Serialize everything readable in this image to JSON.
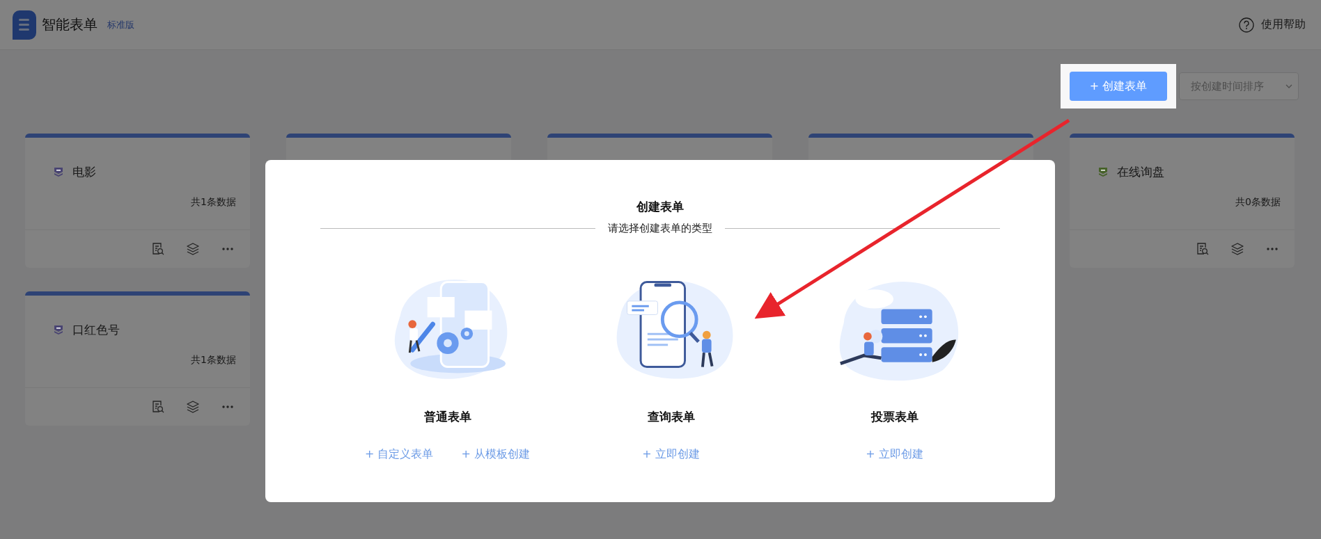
{
  "header": {
    "title": "智能表单",
    "edition": "标准版",
    "help": "使用帮助"
  },
  "toolbar": {
    "create_button": "+ 创建表单",
    "sort_select": {
      "value": "按创建时间排序"
    }
  },
  "cards": [
    {
      "kind": "form",
      "title": "电影",
      "count": "共1条数据",
      "color": "#494472"
    },
    {
      "kind": "covered"
    },
    {
      "kind": "covered"
    },
    {
      "kind": "covered"
    },
    {
      "kind": "form",
      "title": "在线询盘",
      "count": "共0条数据",
      "color": "#47622a"
    },
    {
      "kind": "form",
      "title": "口红色号",
      "count": "共1条数据",
      "color": "#494472"
    }
  ],
  "dialog": {
    "title": "创建表单",
    "subtitle": "请选择创建表单的类型",
    "types": [
      {
        "kind": "tools",
        "name": "普通表单",
        "links": [
          "+ 自定义表单",
          "+ 从模板创建"
        ]
      },
      {
        "kind": "search",
        "name": "查询表单",
        "links": [
          "+ 立即创建"
        ]
      },
      {
        "kind": "server",
        "name": "投票表单",
        "links": [
          "+ 立即创建"
        ]
      }
    ]
  }
}
